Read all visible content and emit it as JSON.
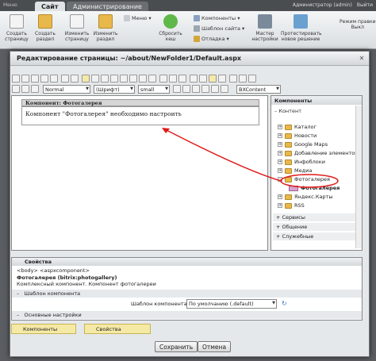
{
  "topbar": {
    "logo": "Меню",
    "tab_site": "Сайт",
    "tab_admin": "Администрирование",
    "admin_user": "Администратор (admin)",
    "exit": "Выйти"
  },
  "ribbon": {
    "buttons": [
      {
        "label": "Создать страницу"
      },
      {
        "label": "Создать раздел"
      },
      {
        "label": "Изменить страницу"
      },
      {
        "label": "Изменить раздел"
      },
      {
        "label": "Сбросить кеш"
      },
      {
        "label": "Мастер настройки"
      },
      {
        "label": "Протестировать новое решение"
      }
    ],
    "menu": "Меню",
    "components": "Компоненты",
    "site_template": "Шаблон сайта",
    "debug": "Отладка",
    "edit_mode_title": "Режим правки",
    "edit_mode_value": "Выкл"
  },
  "dialog": {
    "title": "Редактирование страницы: ~/about/NewFolder1/Default.aspx",
    "close": "✕"
  },
  "toolbar": {
    "style_select": "Normal",
    "font_select": "(Шрифт)",
    "size_select": "small",
    "content_select": "BXContent"
  },
  "editor": {
    "component_header": "Компонент: Фотогалерея",
    "component_message": "Компонент \"Фотогалерея\" необходимо настроить"
  },
  "right_panel": {
    "title": "Компоненты",
    "tab_content": "Контент",
    "tree": [
      "Каталог",
      "Новости",
      "Google Maps",
      "Добавление элементов",
      "Инфоблоки",
      "Медиа",
      "Фотогалерея"
    ],
    "selected_component": "Фотогалерея",
    "tree_more": [
      "Яндекс.Карты",
      "RSS"
    ],
    "groups": [
      "Сервисы",
      "Общение",
      "Служебные"
    ]
  },
  "properties": {
    "title": "Свойства",
    "breadcrumb": "<body> <aspxcomponent>",
    "component_code": "Фотогалерея (bitrix:photogallery)",
    "component_desc": "Комплексный компонент. Компонент фотогалереи",
    "section_template": "Шаблон компонента",
    "template_label": "Шаблон компонента:",
    "template_value": "По умолчанию (.default)",
    "section_main": "Основные настройки"
  },
  "bottom_tabs": {
    "components": "Компоненты",
    "properties": "Свойства"
  },
  "buttons": {
    "save": "Сохранить",
    "cancel": "Отмена"
  },
  "colors": {
    "arrow": "#e01818",
    "highlight_oval": "#e01818",
    "folder": "#e8b84a"
  }
}
